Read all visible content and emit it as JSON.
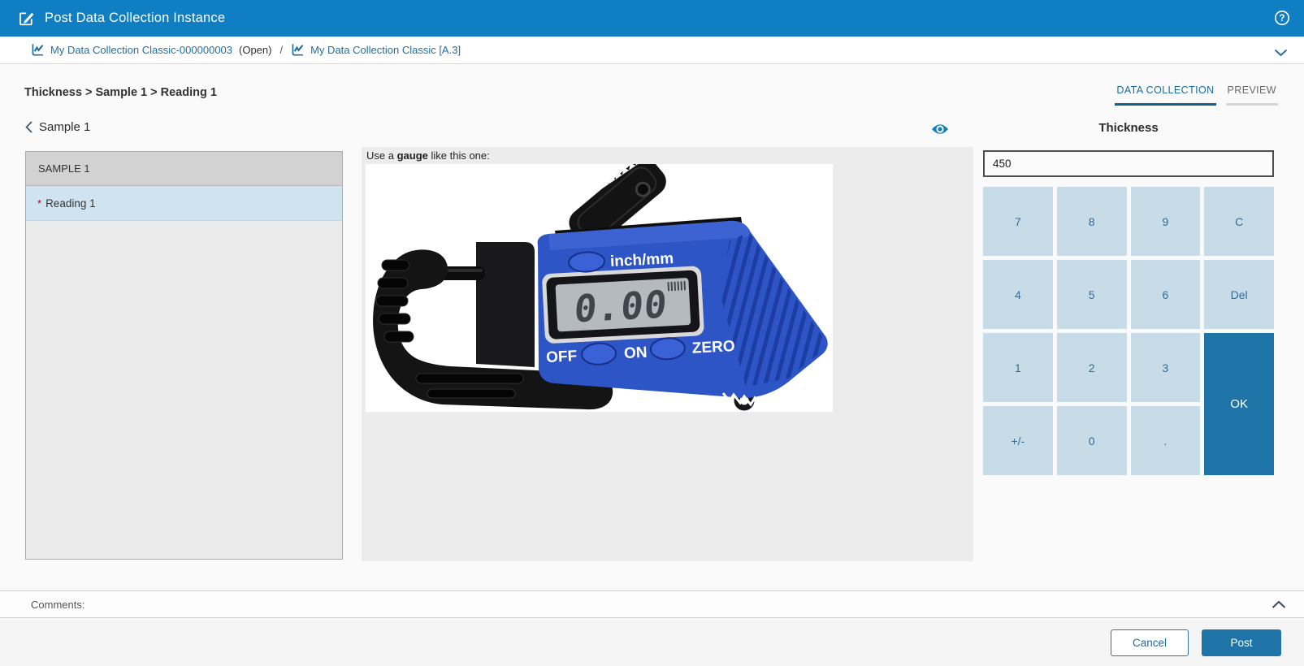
{
  "header": {
    "title": "Post Data Collection Instance"
  },
  "breadcrumb": {
    "collection_link": "My Data Collection Classic-000000003",
    "status": "(Open)",
    "separator": "/",
    "spec_link": "My Data Collection Classic [A.3]"
  },
  "context_path": "Thickness > Sample 1 > Reading 1",
  "tabs": [
    {
      "label": "DATA COLLECTION",
      "active": true
    },
    {
      "label": "PREVIEW",
      "active": false
    }
  ],
  "back_nav": {
    "label": "Sample 1"
  },
  "sample_list": {
    "group_header": "SAMPLE 1",
    "items": [
      {
        "label": "Reading 1",
        "required_marker": "*",
        "selected": true
      }
    ]
  },
  "gauge_panel": {
    "instruction_prefix": "Use a ",
    "instruction_bold": "gauge",
    "instruction_suffix": " like this one:",
    "image": {
      "display_value": "0.00",
      "unit_button_label": "inch/mm",
      "off_label": "OFF",
      "on_label": "ON",
      "zero_label": "ZERO"
    }
  },
  "entry": {
    "title": "Thickness",
    "value": "450",
    "keypad": [
      {
        "label": "7"
      },
      {
        "label": "8"
      },
      {
        "label": "9"
      },
      {
        "label": "C"
      },
      {
        "label": "4"
      },
      {
        "label": "5"
      },
      {
        "label": "6"
      },
      {
        "label": "Del"
      },
      {
        "label": "1"
      },
      {
        "label": "2"
      },
      {
        "label": "3"
      },
      {
        "label": "OK"
      },
      {
        "label": "+/-"
      },
      {
        "label": "0"
      },
      {
        "label": "."
      }
    ]
  },
  "comments": {
    "label": "Comments:"
  },
  "footer": {
    "cancel_label": "Cancel",
    "post_label": "Post"
  },
  "icons": {
    "app": "edit-note-icon",
    "help": "help-circle-icon",
    "breadcrumb": "line-chart-icon",
    "expand": "chevron-down-icon",
    "back": "chevron-left-icon",
    "visibility": "eye-icon",
    "collapse": "chevron-up-icon"
  },
  "colors": {
    "header_bg": "#0F7EC2",
    "link": "#1D6EA8",
    "accent": "#1E74A7",
    "keypad_bg": "#C8DCE8",
    "keypad_text": "#2F6C99",
    "selected_row_bg": "#CFE3F1",
    "active_tab": "#1A6B9E",
    "gauge_blue": "#2E55C5"
  }
}
